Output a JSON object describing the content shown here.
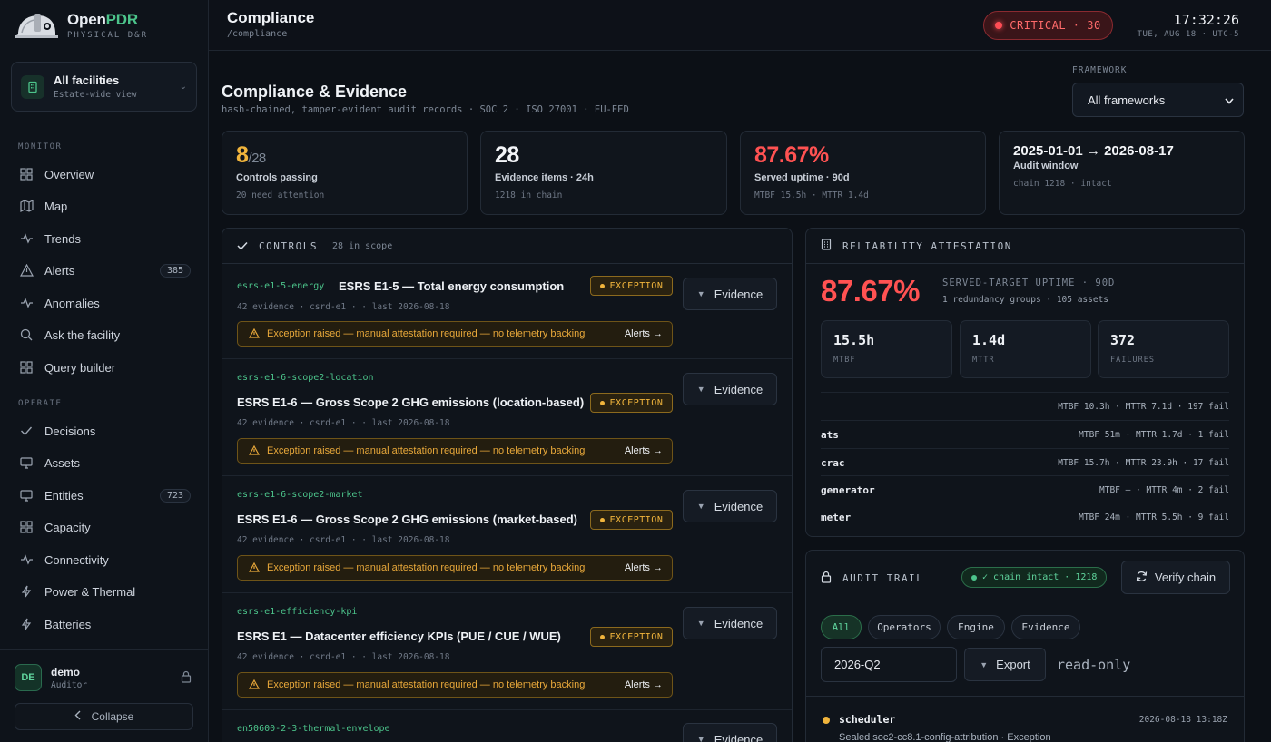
{
  "brand": {
    "name_main": "Open",
    "name_accent": "PDR",
    "subtitle": "PHYSICAL D&R"
  },
  "facility": {
    "title": "All facilities",
    "subtitle": "Estate-wide view"
  },
  "sidebar": {
    "monitor_label": "MONITOR",
    "operate_label": "OPERATE",
    "monitor_items": [
      {
        "label": "Overview",
        "icon": "grid-icon"
      },
      {
        "label": "Map",
        "icon": "map-icon"
      },
      {
        "label": "Trends",
        "icon": "pulse-icon"
      },
      {
        "label": "Alerts",
        "icon": "warning-icon",
        "badge": "385"
      },
      {
        "label": "Anomalies",
        "icon": "pulse-icon"
      },
      {
        "label": "Ask the facility",
        "icon": "search-icon"
      },
      {
        "label": "Query builder",
        "icon": "grid-icon"
      }
    ],
    "operate_items": [
      {
        "label": "Decisions",
        "icon": "check-icon"
      },
      {
        "label": "Assets",
        "icon": "monitor-icon"
      },
      {
        "label": "Entities",
        "icon": "monitor-icon",
        "badge": "723"
      },
      {
        "label": "Capacity",
        "icon": "grid-icon"
      },
      {
        "label": "Connectivity",
        "icon": "pulse-icon"
      },
      {
        "label": "Power & Thermal",
        "icon": "bolt-icon"
      },
      {
        "label": "Batteries",
        "icon": "bolt-icon"
      }
    ],
    "user": {
      "initials": "DE",
      "name": "demo",
      "role": "Auditor"
    },
    "collapse_label": "Collapse"
  },
  "topbar": {
    "title": "Compliance",
    "path": "/compliance",
    "critical_label": "CRITICAL · 30",
    "time": "17:32:26",
    "date": "TUE, AUG 18 · UTC-5"
  },
  "page": {
    "title": "Compliance & Evidence",
    "subtitle": "hash-chained, tamper-evident audit records · SOC 2 · ISO 27001 · EU-EED",
    "framework_label": "FRAMEWORK",
    "framework_value": "All frameworks"
  },
  "stats": [
    {
      "big": "8",
      "suffix": "/28",
      "label": "Controls passing",
      "meta": "20 need attention",
      "color": "#f0b43c"
    },
    {
      "big": "28",
      "suffix": "",
      "label": "Evidence items · 24h",
      "meta": "1218 in chain",
      "color": "#f3f5f8"
    },
    {
      "big": "87.67%",
      "suffix": "",
      "label": "Served uptime · 90d",
      "meta": "MTBF 15.5h · MTTR 1.4d",
      "color": "#ff5252"
    },
    {
      "big": "2025-01-01 → 2026-08-17",
      "suffix": "",
      "label": "Audit window",
      "meta": "chain 1218 · intact",
      "color": "#f3f5f8"
    }
  ],
  "controls": {
    "title": "CONTROLS",
    "count": "28 in scope",
    "evidence_label": "Evidence",
    "items": [
      {
        "id": "esrs-e1-5-energy",
        "name": "ESRS E1-5 — Total energy consumption",
        "meta": "42 evidence · csrd-e1 · · last 2026-08-18",
        "badge": "EXCEPTION",
        "warning": "Exception raised — manual attestation required — no telemetry backing",
        "link": "Alerts →"
      },
      {
        "id": "esrs-e1-6-scope2-location",
        "name": "ESRS E1-6 — Gross Scope 2 GHG emissions (location-based)",
        "meta": "42 evidence · csrd-e1 · · last 2026-08-18",
        "badge": "EXCEPTION",
        "warning": "Exception raised — manual attestation required — no telemetry backing",
        "link": "Alerts →"
      },
      {
        "id": "esrs-e1-6-scope2-market",
        "name": "ESRS E1-6 — Gross Scope 2 GHG emissions (market-based)",
        "meta": "42 evidence · csrd-e1 · · last 2026-08-18",
        "badge": "EXCEPTION",
        "warning": "Exception raised — manual attestation required — no telemetry backing",
        "link": "Alerts →"
      },
      {
        "id": "esrs-e1-efficiency-kpi",
        "name": "ESRS E1 — Datacenter efficiency KPIs (PUE / CUE / WUE)",
        "meta": "42 evidence · csrd-e1 · · last 2026-08-18",
        "badge": "EXCEPTION",
        "warning": "Exception raised — manual attestation required — no telemetry backing",
        "link": "Alerts →"
      },
      {
        "id": "en50600-2-3-thermal-envelope"
      }
    ]
  },
  "reliability": {
    "title": "RELIABILITY ATTESTATION",
    "big": "87.67%",
    "label": "SERVED-TARGET UPTIME · 90D",
    "sub": "1 redundancy groups · 105 assets",
    "metrics": [
      {
        "value": "15.5h",
        "label": "MTBF"
      },
      {
        "value": "1.4d",
        "label": "MTTR"
      },
      {
        "value": "372",
        "label": "FAILURES"
      }
    ],
    "rows": [
      {
        "name": "",
        "value": "MTBF 10.3h · MTTR 7.1d · 197 fail"
      },
      {
        "name": "ats",
        "value": "MTBF 51m · MTTR 1.7d · 1 fail"
      },
      {
        "name": "crac",
        "value": "MTBF 15.7h · MTTR 23.9h · 17 fail"
      },
      {
        "name": "generator",
        "value": "MTBF — · MTTR 4m · 2 fail"
      },
      {
        "name": "meter",
        "value": "MTBF 24m · MTTR 5.5h · 9 fail"
      }
    ]
  },
  "audit": {
    "title": "AUDIT TRAIL",
    "chain_badge": "✓ chain intact · 1218",
    "verify_label": "Verify chain",
    "filters": [
      "All",
      "Operators",
      "Engine",
      "Evidence"
    ],
    "quarter": "2026-Q2",
    "export_label": "Export",
    "readonly": "read-only",
    "entries": [
      {
        "actor": "scheduler",
        "time": "2026-08-18 13:18Z",
        "message": "Sealed soc2-cc8.1-config-attribution · Exception"
      }
    ]
  }
}
